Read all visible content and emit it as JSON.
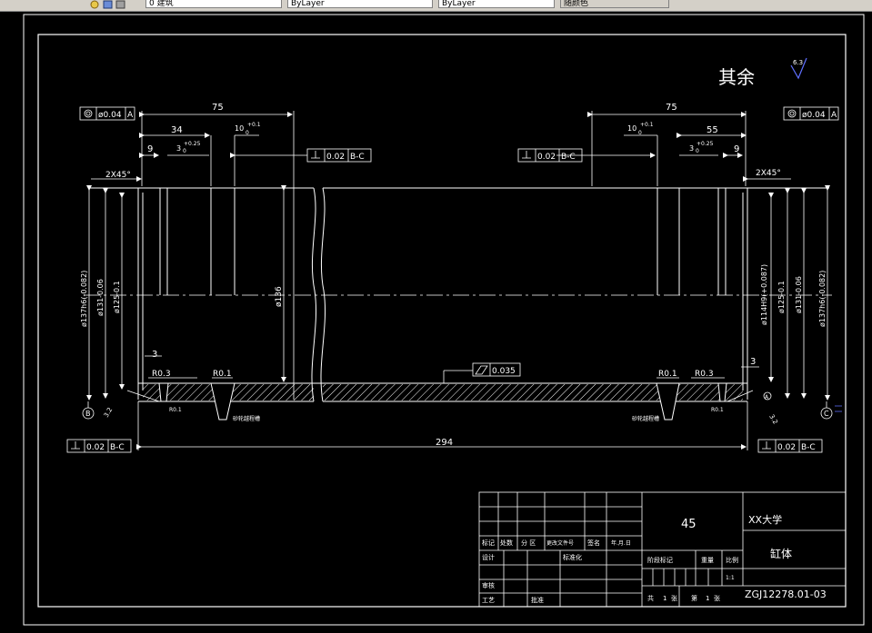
{
  "toolbar": {
    "layer_value": "0 建筑",
    "linetype_value": "ByLayer",
    "lineweight_value": "ByLayer",
    "plotstyle_value": "随颜色"
  },
  "drawing": {
    "roughness_note": "其余",
    "roughness_value": "6.3",
    "dims": {
      "len_75_left": "75",
      "len_34": "34",
      "len_9_left": "9",
      "len_3_left": "3",
      "len_10_left": "10",
      "len_10_left_tol": "+0.1",
      "len_0_left": "0",
      "len_3_left_groove": "3",
      "len_3_left_groove_tol": "+0.25",
      "len_3_left_groove_low": "0",
      "chamfer_left": "2X45°",
      "len_75_right": "75",
      "len_55": "55",
      "len_9_right": "9",
      "len_3_right": "3",
      "len_10_right": "10",
      "len_10_right_tol": "+0.1",
      "len_0_right": "0",
      "len_3_right_groove": "3",
      "len_3_right_groove_tol": "+0.25",
      "len_3_right_groove_low": "0",
      "chamfer_right": "2X45°",
      "overall_294": "294",
      "dia_137_left": "ø137h6(-0.082)",
      "dia_131_left": "ø131-0.06",
      "dia_125_left": "ø125-0.1",
      "dia_136": "ø136",
      "dia_114_right": "ø114H9(+0.087)",
      "dia_125_right": "ø125-0.1",
      "dia_131_right": "ø131-0.06",
      "dia_137_right": "ø137h6(-0.082)",
      "r03_left": "R0.3",
      "r01_left": "R0.1",
      "r01_left_small": "R0.1",
      "r03_right": "R0.3",
      "r01_right": "R0.1",
      "r01_right_small": "R0.1",
      "undercut_left": "砂轮越程槽",
      "undercut_right": "砂轮越程槽",
      "rough_left": "3.2",
      "rough_right": "3.2"
    },
    "fcf": {
      "runout_left_val": "ø0.04",
      "runout_left_datum": "A",
      "runout_right_val": "ø0.04",
      "runout_right_datum": "A",
      "perp_left_top_val": "0.02",
      "perp_left_top_datum": "B-C",
      "perp_right_top_val": "0.02",
      "perp_right_top_datum": "B-C",
      "perp_left_bot_val": "0.02",
      "perp_left_bot_datum": "B-C",
      "perp_right_bot_val": "0.02",
      "perp_right_bot_datum": "B-C",
      "cyl_val": "0.035"
    },
    "datums": {
      "left": "B",
      "right": "C",
      "center": "A"
    },
    "title_block": {
      "material": "45",
      "school": "XX大学",
      "part_name": "缸体",
      "drawing_no": "ZGJ12278.01-03",
      "h_mark": "标记",
      "h_count": "处数",
      "h_zone": "分 区",
      "h_doc": "更改文件号",
      "h_sign": "签名",
      "h_date": "年.月.日",
      "h_design": "设计",
      "h_std": "标准化",
      "h_stage": "阶段标记",
      "h_weight": "重量",
      "h_scale": "比例",
      "scale_val": "1:1",
      "h_review": "审核",
      "h_process": "工艺",
      "h_approve": "批准",
      "sheet_total_label": "共",
      "sheet_total": "1",
      "sheet_total_unit": "张",
      "sheet_no_label": "第",
      "sheet_no": "1",
      "sheet_no_unit": "张"
    }
  }
}
